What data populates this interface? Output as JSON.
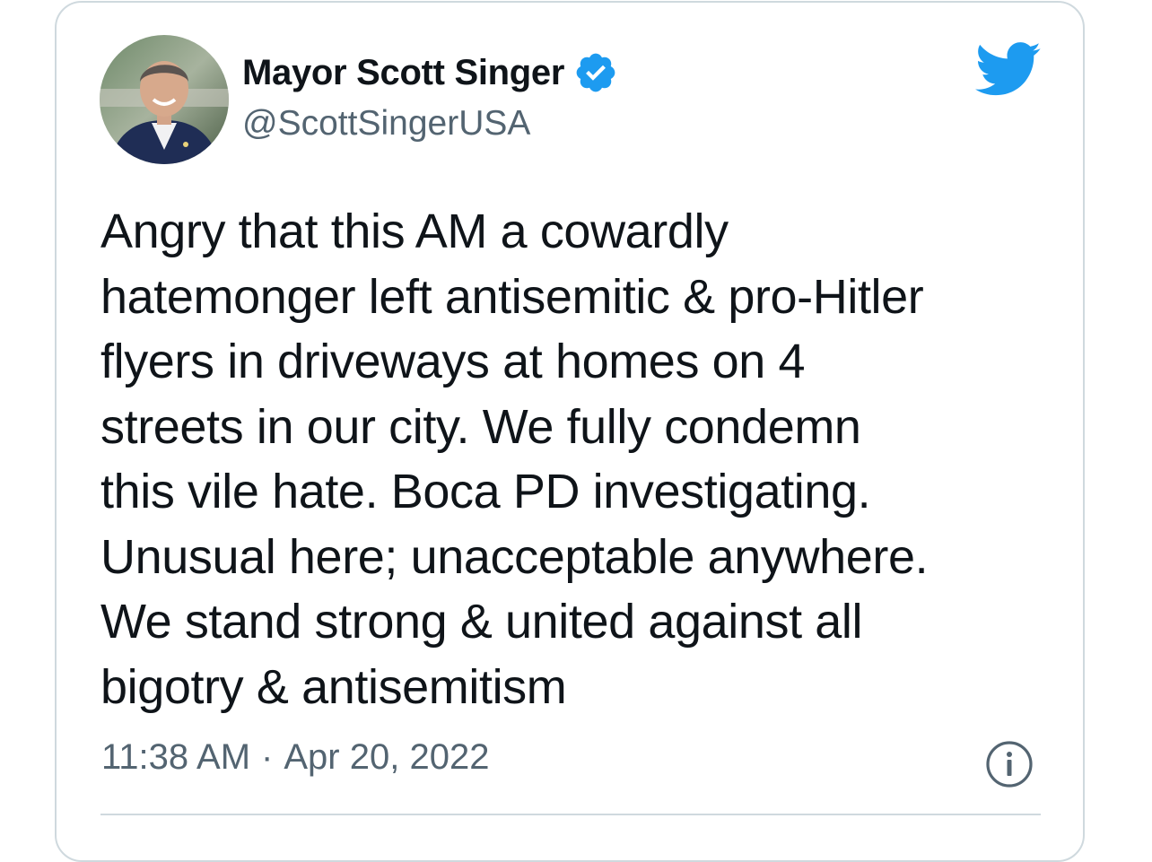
{
  "tweet": {
    "author": {
      "display_name": "Mayor Scott Singer",
      "handle": "@ScottSingerUSA",
      "verified_icon": "verified-badge-icon",
      "avatar": "avatar-photo"
    },
    "brand_icon": "twitter-bird-icon",
    "text_lines": [
      "Angry that this AM a cowardly",
      "hatemonger left antisemitic & pro-Hitler",
      "flyers in driveways at homes on 4",
      "streets in our city. We fully condemn",
      "this vile hate. Boca PD investigating.",
      "Unusual here; unacceptable anywhere.",
      "We stand strong & united against all",
      "bigotry & antisemitism"
    ],
    "time": "11:38 AM",
    "separator": "·",
    "date": "Apr 20, 2022",
    "info_icon": "info-icon"
  },
  "colors": {
    "text_primary": "#0f1419",
    "text_secondary": "#536471",
    "twitter_blue": "#1d9bf0",
    "border": "#cfd9de"
  }
}
